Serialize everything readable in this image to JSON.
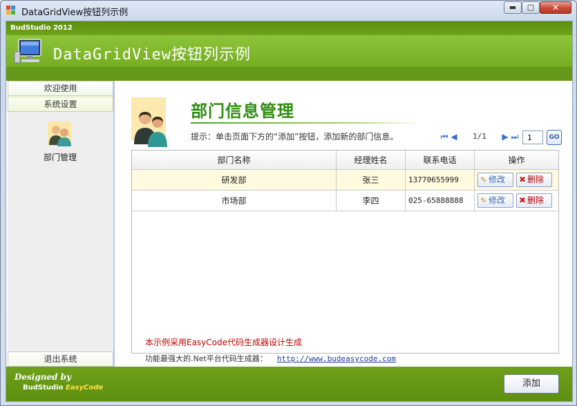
{
  "window": {
    "title": "DataGridView按钮列示例",
    "buttons": {
      "minimize": "▬",
      "maximize": "□",
      "close": "✕"
    }
  },
  "header": {
    "brand_small": "BudStudio 2012",
    "title": "DataGridView按钮列示例"
  },
  "sidebar": {
    "items": [
      {
        "label": "欢迎使用"
      },
      {
        "label": "系统设置"
      }
    ],
    "panel_item": {
      "label": "部门管理",
      "icon": "people-icon"
    },
    "exit": {
      "label": "退出系统"
    }
  },
  "main": {
    "section_title": "部门信息管理",
    "hint": "提示：单击页面下方的“添加”按钮，添加新的部门信息。",
    "pager": {
      "info": "1/1",
      "page_input": "1",
      "go_label": "GO"
    },
    "grid": {
      "columns": [
        "部门名称",
        "经理姓名",
        "联系电话",
        "操作"
      ],
      "rows": [
        {
          "name": "研发部",
          "manager": "张三",
          "phone": "13770655999",
          "edit": "修改",
          "delete": "删除",
          "highlighted": true
        },
        {
          "name": "市场部",
          "manager": "李四",
          "phone": "025-65888888",
          "edit": "修改",
          "delete": "删除",
          "highlighted": false
        }
      ]
    },
    "promo": "本示例采用EasyCode代码生成器设计生成",
    "promo2_text": "功能最强大的.Net平台代码生成器：",
    "promo2_link": "http://www.budeasycode.com"
  },
  "footer": {
    "designed_by": "Designed by",
    "studio": "BudStudio",
    "product": "EasyCode",
    "add_button": "添加"
  },
  "colors": {
    "brand_green": "#7fb326",
    "title_green": "#2f8c10",
    "promo_red": "#c00000",
    "highlight_row": "#fffadf"
  }
}
